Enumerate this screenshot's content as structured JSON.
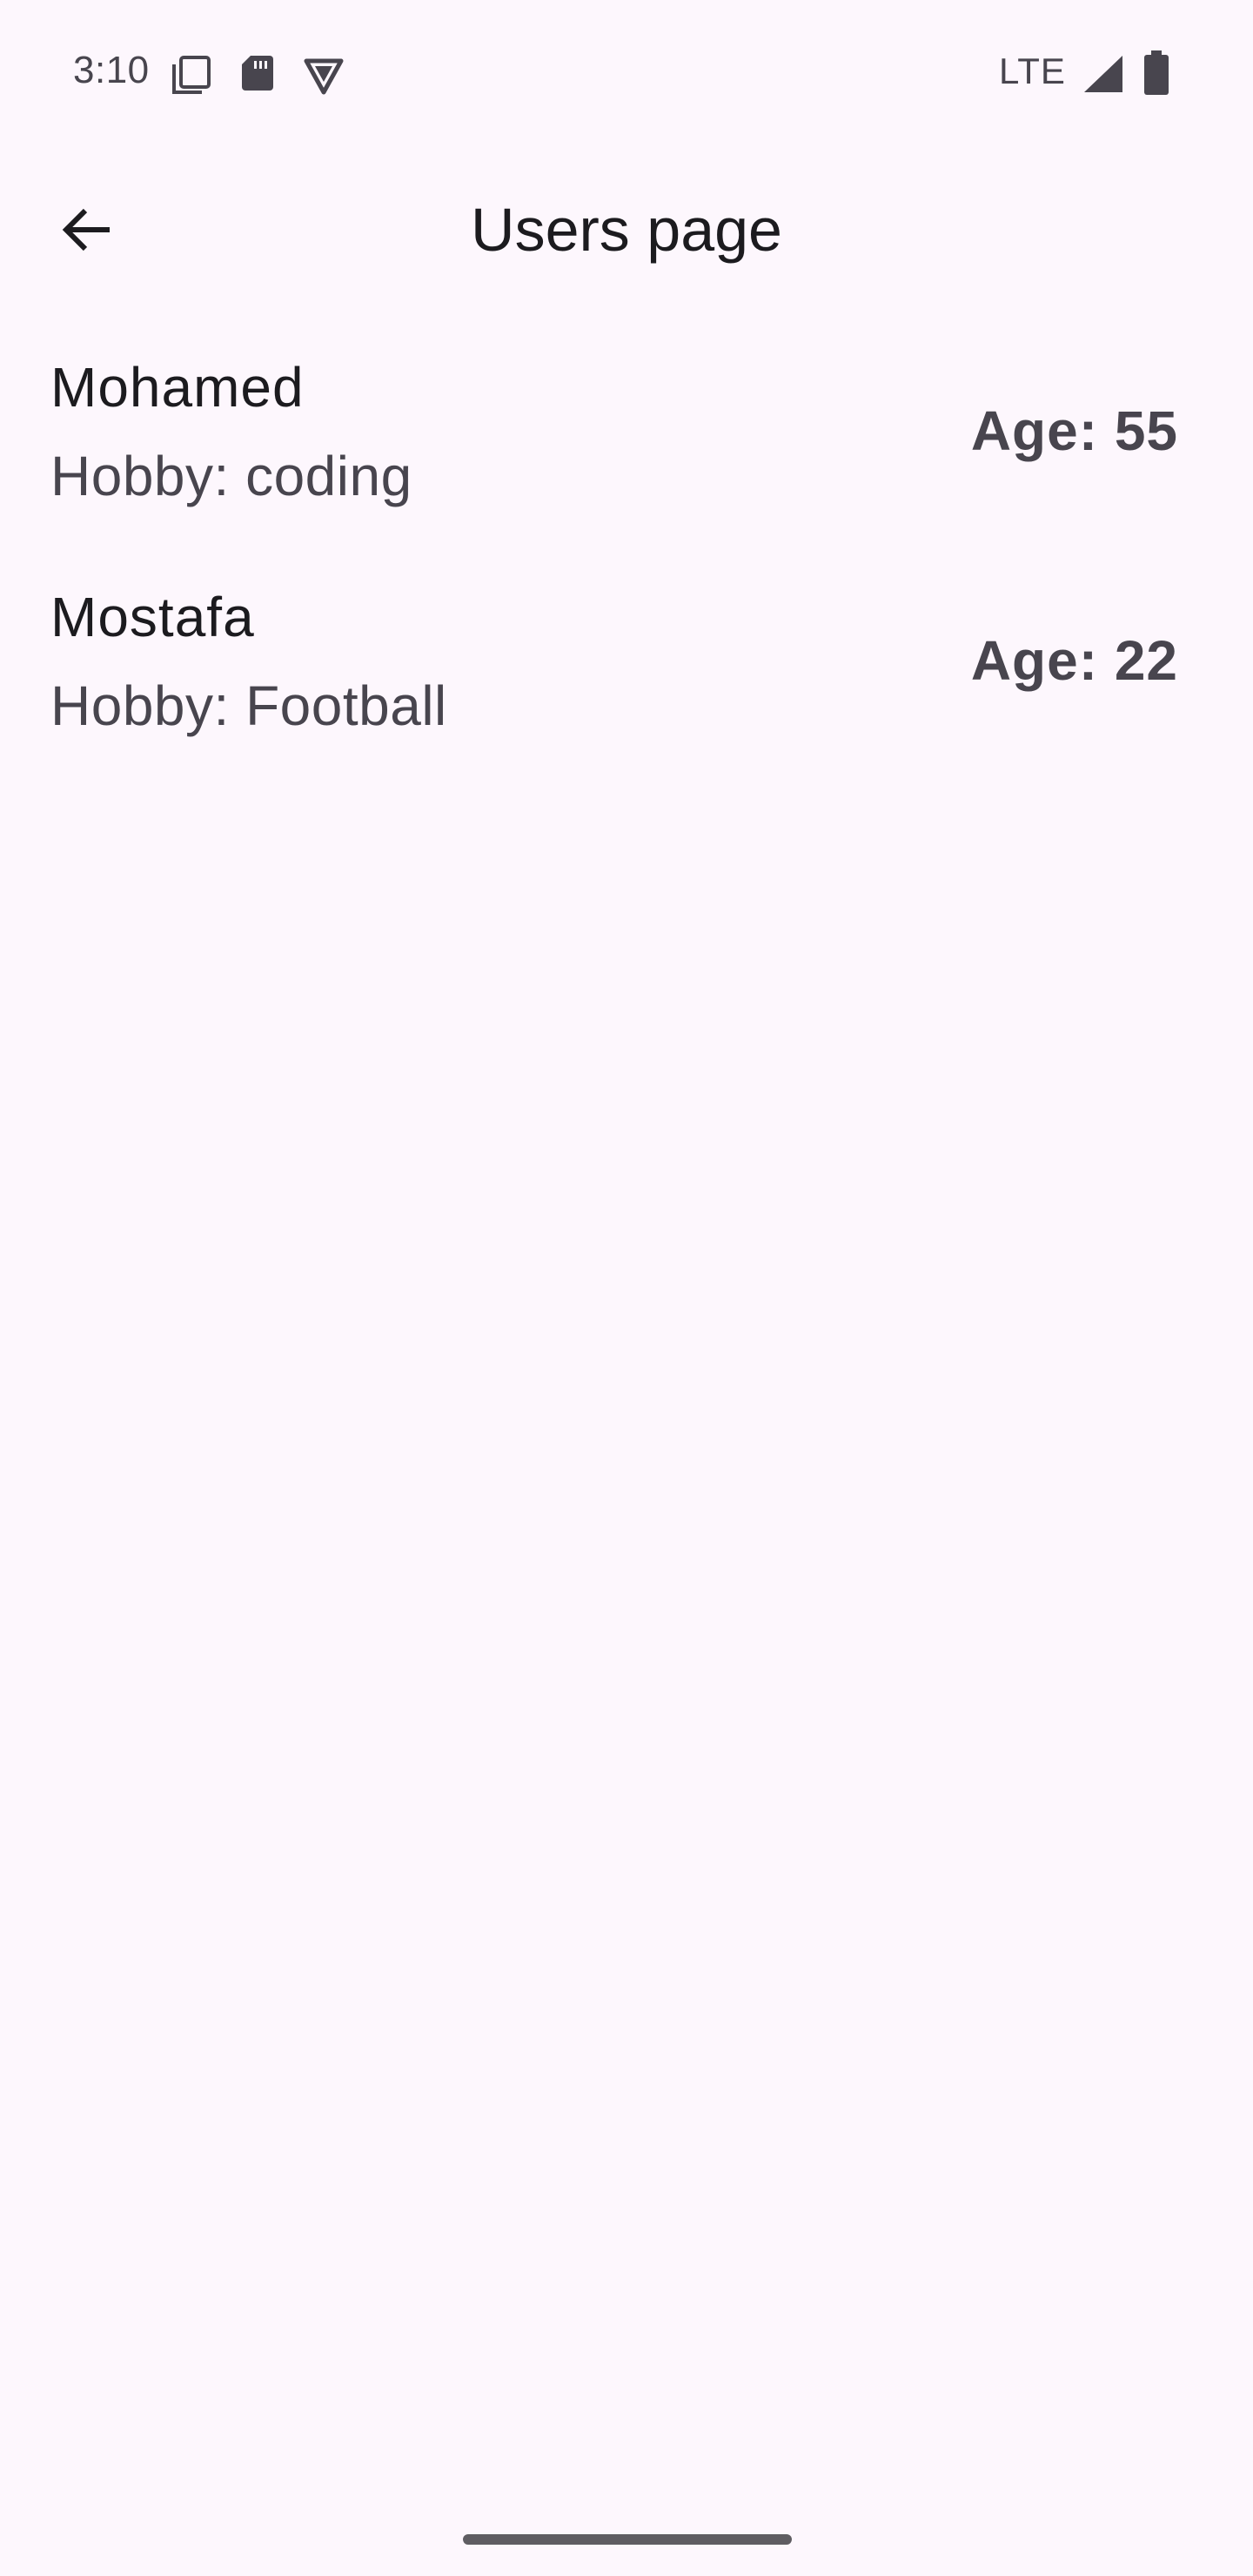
{
  "status_bar": {
    "time": "3:10",
    "network": "LTE",
    "left_icons": [
      "screenshot-icon",
      "sd-card-icon",
      "vpn-shield-icon"
    ],
    "right_icons": [
      "signal-icon",
      "battery-icon"
    ]
  },
  "app_bar": {
    "back_icon": "arrow-back-icon",
    "title": "Users page"
  },
  "users": [
    {
      "name": "Mohamed",
      "hobby": "Hobby: coding",
      "age": "Age: 55"
    },
    {
      "name": "Mostafa",
      "hobby": "Hobby: Football",
      "age": "Age: 22"
    }
  ],
  "colors": {
    "background": "#fdf7fd",
    "text_primary": "#1c1b1f",
    "text_secondary": "#48454e"
  }
}
